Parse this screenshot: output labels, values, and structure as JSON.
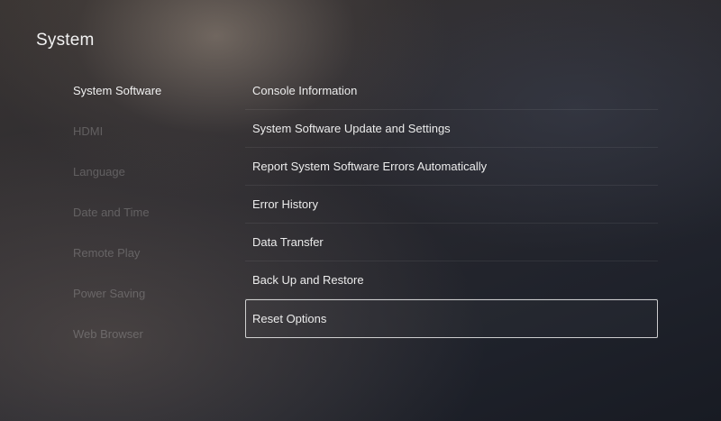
{
  "header": {
    "title": "System"
  },
  "sidebar": {
    "items": [
      {
        "label": "System Software"
      },
      {
        "label": "HDMI"
      },
      {
        "label": "Language"
      },
      {
        "label": "Date and Time"
      },
      {
        "label": "Remote Play"
      },
      {
        "label": "Power Saving"
      },
      {
        "label": "Web Browser"
      }
    ],
    "selected": "System Software"
  },
  "menu": {
    "items": [
      {
        "label": "Console Information"
      },
      {
        "label": "System Software Update and Settings"
      },
      {
        "label": "Report System Software Errors Automatically"
      },
      {
        "label": "Error History"
      },
      {
        "label": "Data Transfer"
      },
      {
        "label": "Back Up and Restore"
      },
      {
        "label": "Reset Options"
      }
    ],
    "focused": "Reset Options"
  }
}
